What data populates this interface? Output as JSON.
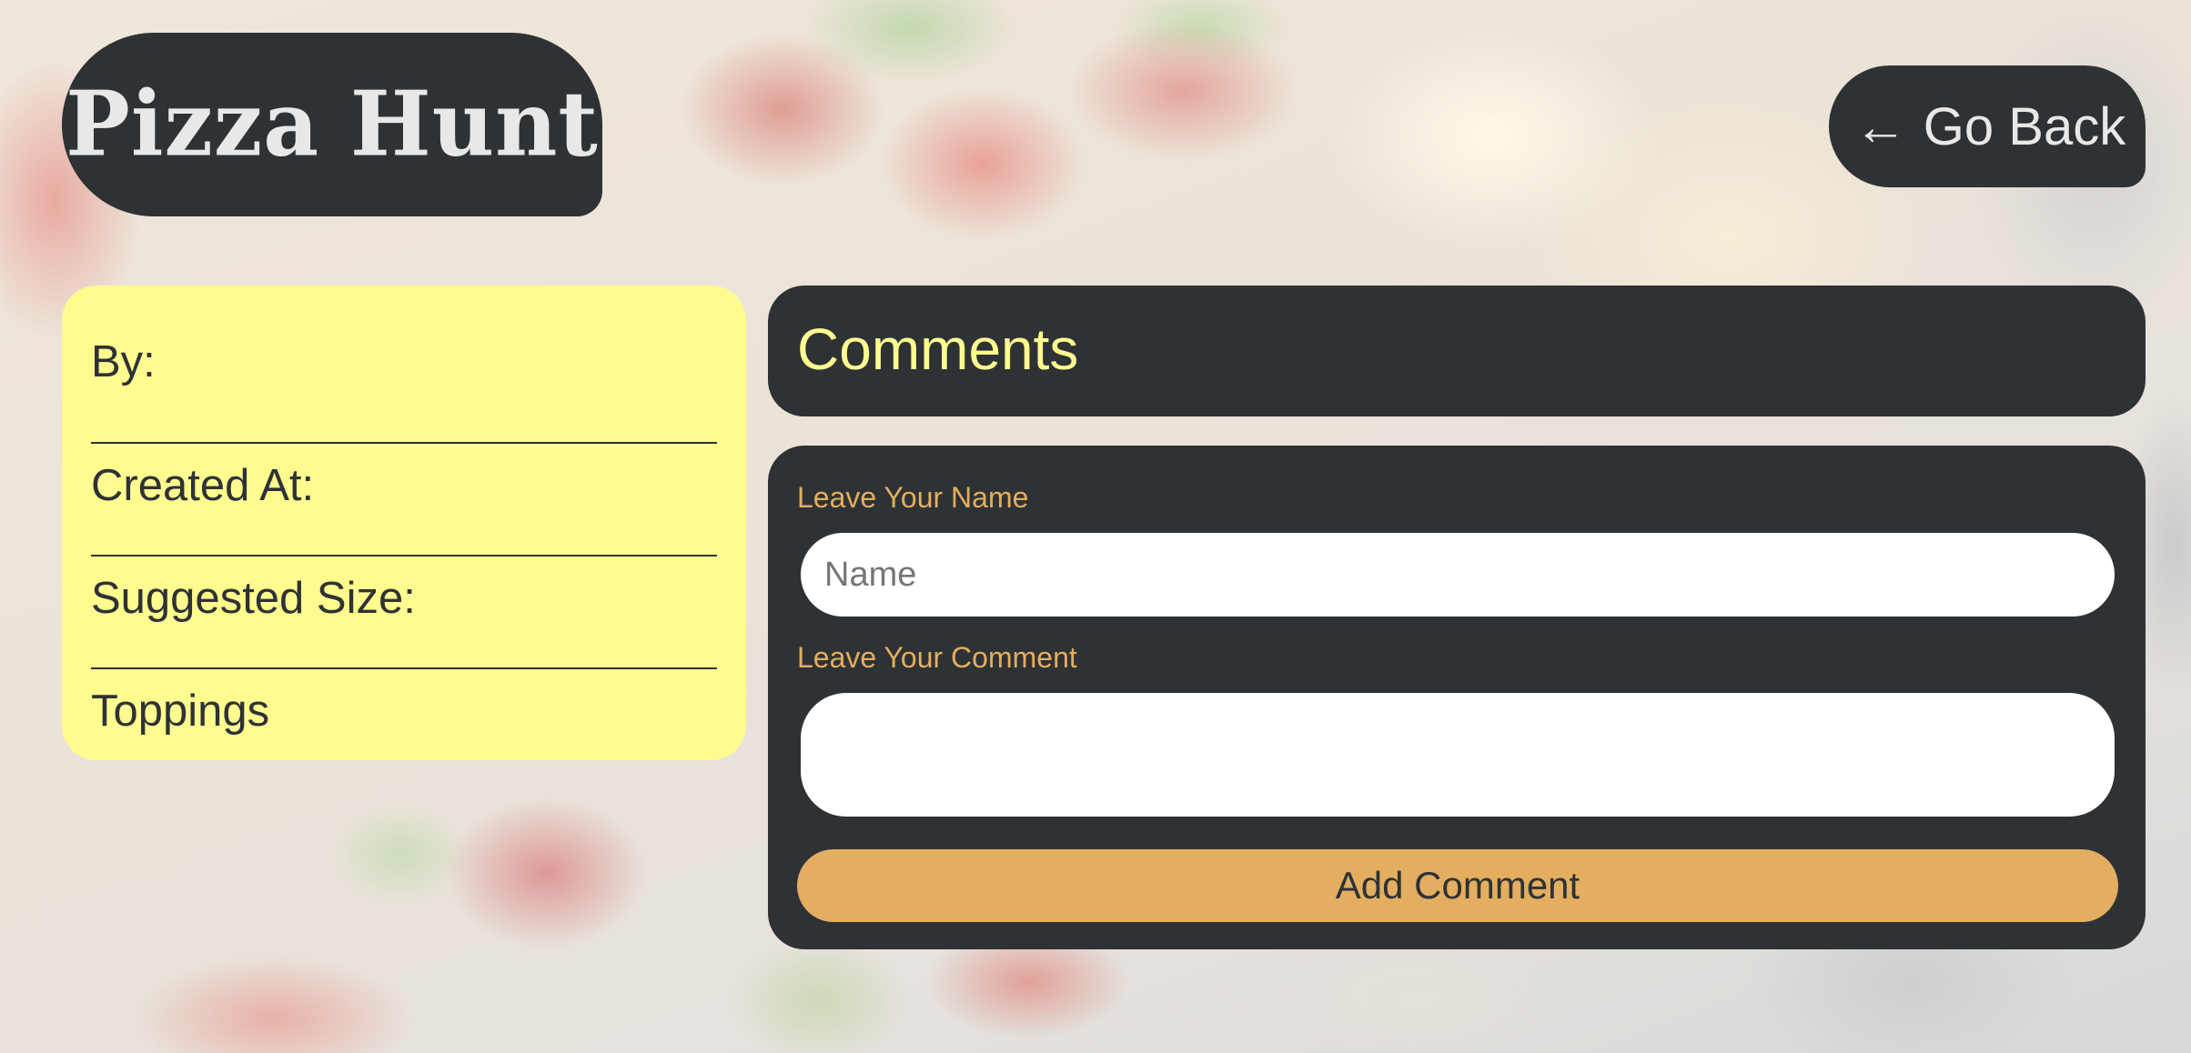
{
  "header": {
    "logo_text": "Pizza Hunt",
    "go_back": {
      "arrow": "←",
      "label": "Go Back"
    }
  },
  "pizza_info": {
    "rows": [
      {
        "label": "By:"
      },
      {
        "label": "Created At:"
      },
      {
        "label": "Suggested Size:"
      },
      {
        "label": "Toppings"
      }
    ]
  },
  "comments": {
    "title": "Comments",
    "form": {
      "name_label": "Leave Your Name",
      "name_value": "",
      "name_placeholder": "Name",
      "comment_label": "Leave Your Comment",
      "comment_value": "",
      "submit_label": "Add Comment"
    }
  },
  "theme": {
    "dark": "#2e3235",
    "yellow": "#fffb8f",
    "orange": "#e3ae5f",
    "light_text": "#e8e8e8"
  },
  "icons": {
    "back": "left-arrow-icon"
  }
}
